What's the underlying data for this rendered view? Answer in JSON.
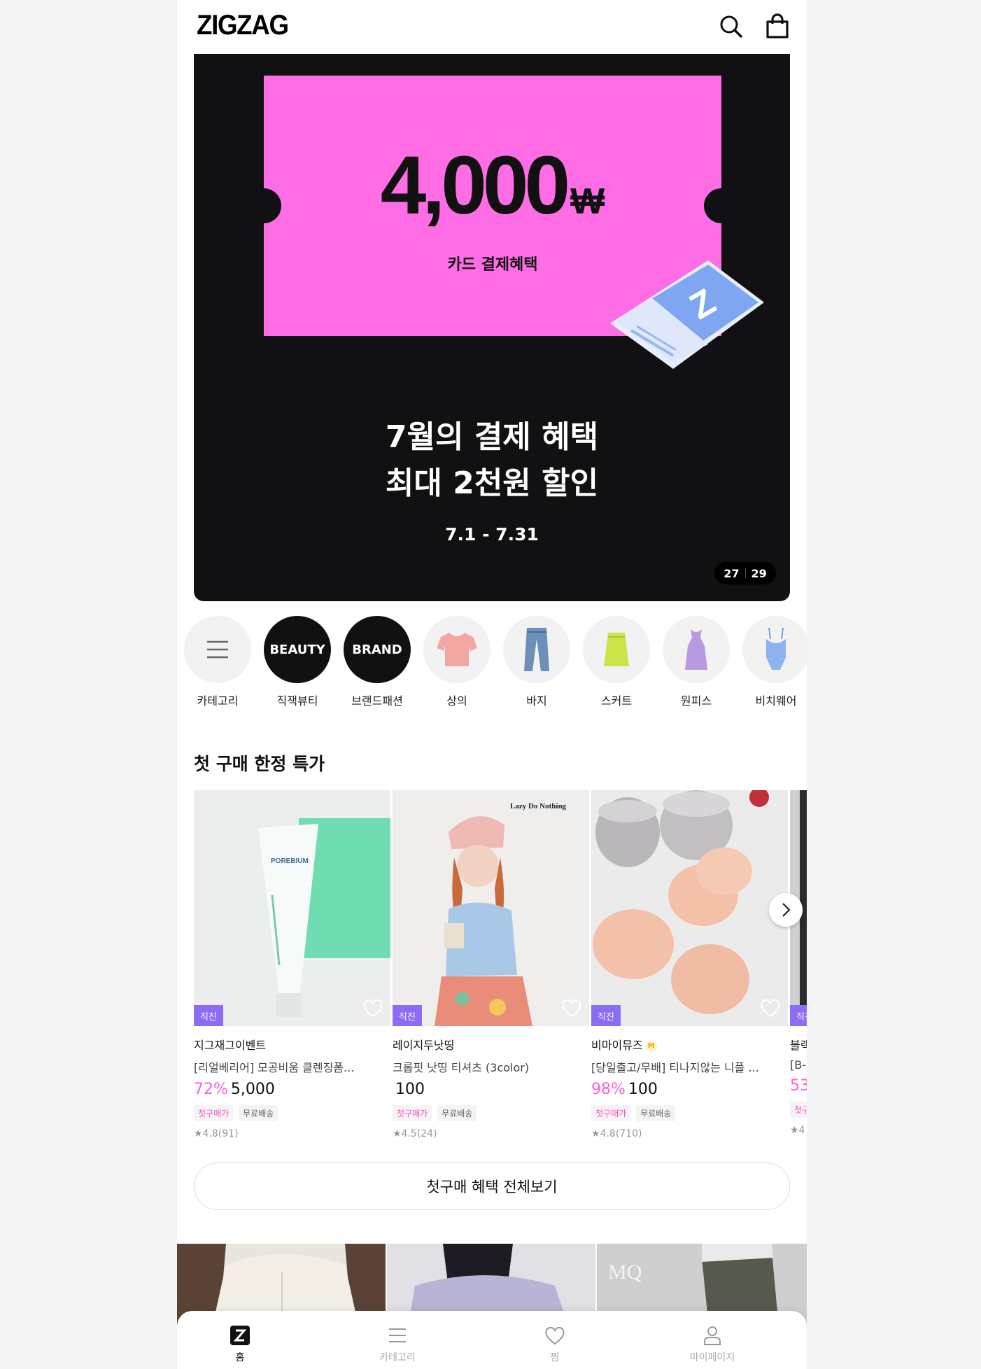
{
  "header": {
    "logo": "ZIGZAG"
  },
  "banner": {
    "amount": "4,000",
    "currency": "₩",
    "ticket_subtitle": "카드 결제혜택",
    "card_letter": "Z",
    "title_line1": "7월의 결제 혜택",
    "title_line2": "최대 2천원 할인",
    "date_range": "7.1 - 7.31",
    "counter_current": "27",
    "counter_total": "29"
  },
  "categories": [
    {
      "label": "카테고리",
      "circle_text": ""
    },
    {
      "label": "직잭뷰티",
      "circle_text": "BEAUTY"
    },
    {
      "label": "브랜드패션",
      "circle_text": "BRAND"
    },
    {
      "label": "상의",
      "circle_text": ""
    },
    {
      "label": "바지",
      "circle_text": ""
    },
    {
      "label": "스커트",
      "circle_text": ""
    },
    {
      "label": "원피스",
      "circle_text": ""
    },
    {
      "label": "비치웨어",
      "circle_text": ""
    }
  ],
  "first_purchase": {
    "title": "첫 구매 한정 특가",
    "products": [
      {
        "badge": "직진",
        "brand": "지그재그이벤트",
        "name": "[리얼베리어] 모공비움 클렌징폼...",
        "discount": "72%",
        "price": "5,000",
        "tags": [
          "첫구매가",
          "무료배송"
        ],
        "rating": "★4.8(91)",
        "image_text": "POREBIUM"
      },
      {
        "badge": "직진",
        "brand": "레이지두낫띵",
        "name": "크롭핏 낫띵 티셔츠 (3color)",
        "discount": "",
        "price": "100",
        "tags": [
          "첫구매가",
          "무료배송"
        ],
        "rating": "★4.5(24)",
        "image_text": "Lazy Do Nothing"
      },
      {
        "badge": "직진",
        "brand": "비마이뮤즈",
        "brand_badge": "M",
        "name": "[당일출고/무배] 티나지않는 니플 ...",
        "discount": "98%",
        "price": "100",
        "tags": [
          "첫구매가",
          "무료배송"
        ],
        "rating": "★4.8(710)",
        "image_text": ""
      },
      {
        "badge": "직진",
        "brand": "블랙",
        "name": "[B-",
        "discount": "53",
        "price": "",
        "tags": [
          "첫구"
        ],
        "rating": "★4",
        "image_text": ""
      }
    ],
    "view_all": "첫구매 혜택 전체보기"
  },
  "lookbook": {
    "watermark": "MQ"
  },
  "bottom_nav": [
    {
      "label": "홈",
      "icon": "home-z-icon",
      "active": true
    },
    {
      "label": "카테고리",
      "icon": "menu-icon",
      "active": false
    },
    {
      "label": "찜",
      "icon": "heart-icon",
      "active": false
    },
    {
      "label": "마이페이지",
      "icon": "person-icon",
      "active": false
    }
  ],
  "colors": {
    "ticket": "#ff6de6",
    "banner_bg": "#111113",
    "discount": "#ff5fd2",
    "badge": "#8a6cf5"
  }
}
